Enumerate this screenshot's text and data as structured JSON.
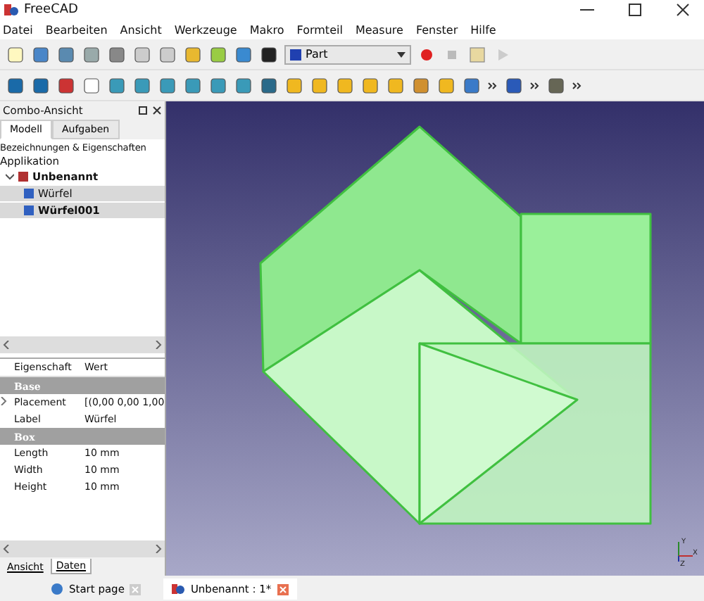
{
  "window": {
    "title": "FreeCAD"
  },
  "menu": [
    "Datei",
    "Bearbeiten",
    "Ansicht",
    "Werkzeuge",
    "Makro",
    "Formteil",
    "Measure",
    "Fenster",
    "Hilfe"
  ],
  "workbench": {
    "value": "Part"
  },
  "combo_view": {
    "title": "Combo-Ansicht",
    "tabs": [
      {
        "label": "Modell",
        "selected": true
      },
      {
        "label": "Aufgaben",
        "selected": false
      }
    ],
    "tree_header": "Bezeichnungen & Eigenschaften",
    "tree": [
      {
        "label": "Applikation",
        "children": [
          {
            "label": "Unbenannt",
            "bold": true,
            "selected": false,
            "expanded": true,
            "children": [
              {
                "label": "Würfel",
                "bold": false,
                "selected": true
              },
              {
                "label": "Würfel001",
                "bold": true,
                "selected": true
              }
            ]
          }
        ]
      }
    ],
    "properties": {
      "columns": [
        "Eigenschaft",
        "Wert"
      ],
      "rows": [
        {
          "kind": "group",
          "name": "Base"
        },
        {
          "kind": "prop",
          "name": "Placement",
          "value": "[(0,00 0,00 1,00",
          "expandable": true
        },
        {
          "kind": "prop",
          "name": "Label",
          "value": "Würfel",
          "expandable": false
        },
        {
          "kind": "group",
          "name": "Box"
        },
        {
          "kind": "prop",
          "name": "Length",
          "value": "10 mm",
          "expandable": false
        },
        {
          "kind": "prop",
          "name": "Width",
          "value": "10 mm",
          "expandable": false
        },
        {
          "kind": "prop",
          "name": "Height",
          "value": "10 mm",
          "expandable": false
        }
      ]
    },
    "bottom_tabs": [
      {
        "label": "Ansicht",
        "selected": false
      },
      {
        "label": "Daten",
        "selected": true
      }
    ]
  },
  "view": {
    "axes": [
      "Y",
      "X",
      "Z"
    ]
  },
  "document_tabs": [
    {
      "label": "Start page",
      "selected": false
    },
    {
      "label": "Unbenannt : 1*",
      "selected": true
    }
  ]
}
